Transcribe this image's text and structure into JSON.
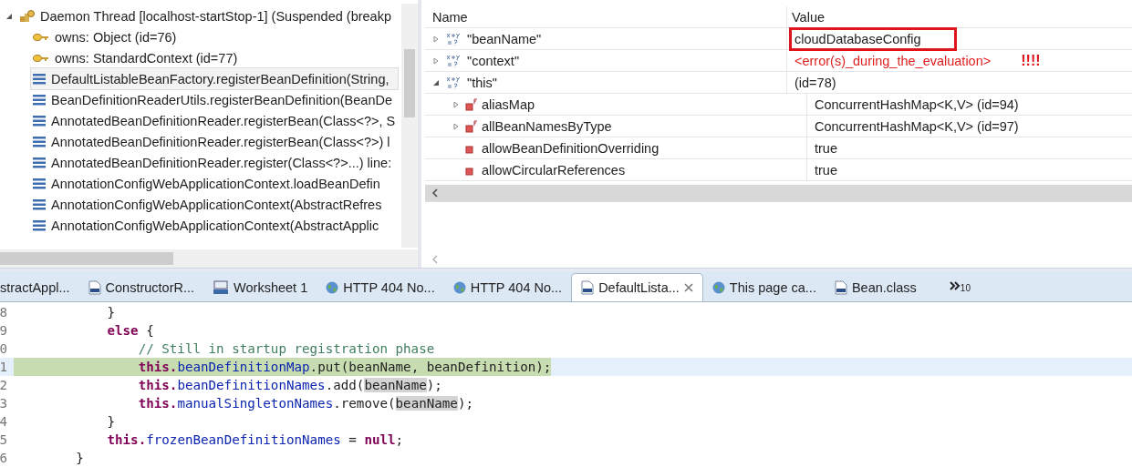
{
  "debug_tree": {
    "thread": {
      "label": "Daemon Thread [localhost-startStop-1] (Suspended (breakp",
      "expanded": true,
      "children": [
        {
          "kind": "monitor",
          "label": "owns: Object  (id=76)",
          "selected": false
        },
        {
          "kind": "monitor",
          "label": "owns: StandardContext  (id=77)",
          "selected": false
        },
        {
          "kind": "frame",
          "label": "DefaultListableBeanFactory.registerBeanDefinition(String,",
          "selected": true
        },
        {
          "kind": "frame",
          "label": "BeanDefinitionReaderUtils.registerBeanDefinition(BeanDe",
          "selected": false
        },
        {
          "kind": "frame",
          "label": "AnnotatedBeanDefinitionReader.registerBean(Class<?>, S",
          "selected": false
        },
        {
          "kind": "frame",
          "label": "AnnotatedBeanDefinitionReader.registerBean(Class<?>) l",
          "selected": false
        },
        {
          "kind": "frame",
          "label": "AnnotatedBeanDefinitionReader.register(Class<?>...) line:",
          "selected": false
        },
        {
          "kind": "frame",
          "label": "AnnotationConfigWebApplicationContext.loadBeanDefin",
          "selected": false
        },
        {
          "kind": "frame",
          "label": "AnnotationConfigWebApplicationContext(AbstractRefres",
          "selected": false
        },
        {
          "kind": "frame",
          "label": "AnnotationConfigWebApplicationContext(AbstractApplic",
          "selected": false
        }
      ]
    }
  },
  "variables": {
    "columns": [
      "Name",
      "Value"
    ],
    "rows": [
      {
        "kind": "local",
        "name": "\"beanName\"",
        "value": "cloudDatabaseConfig",
        "error": false,
        "expandable": true,
        "expanded": false,
        "annotated": true
      },
      {
        "kind": "local",
        "name": "\"context\"",
        "value": "<error(s)_during_the_evaluation>",
        "error": true,
        "expandable": true,
        "expanded": false,
        "annotated": false,
        "note": "!!!!"
      },
      {
        "kind": "local",
        "name": "\"this\"",
        "value": " (id=78)",
        "error": false,
        "expandable": true,
        "expanded": true,
        "annotated": false,
        "children": [
          {
            "kind": "final-field",
            "name": "aliasMap",
            "value": "ConcurrentHashMap<K,V>  (id=94)",
            "error": false,
            "expandable": true,
            "expanded": false,
            "annotated": false
          },
          {
            "kind": "final-field",
            "name": "allBeanNamesByType",
            "value": "ConcurrentHashMap<K,V>  (id=97)",
            "error": false,
            "expandable": true,
            "expanded": false,
            "annotated": false
          },
          {
            "kind": "field",
            "name": "allowBeanDefinitionOverriding",
            "value": "true",
            "error": false,
            "expandable": false,
            "annotated": false
          },
          {
            "kind": "field",
            "name": "allowCircularReferences",
            "value": "true",
            "error": false,
            "expandable": false,
            "annotated": false
          }
        ]
      }
    ]
  },
  "editor_tabs": {
    "overflow_count": "10",
    "tabs": [
      {
        "kind": "none",
        "label": "stractAppl...",
        "selected": false
      },
      {
        "kind": "class",
        "label": "ConstructorR...",
        "selected": false
      },
      {
        "kind": "sql",
        "label": "Worksheet 1",
        "selected": false
      },
      {
        "kind": "web",
        "label": "HTTP 404 No...",
        "selected": false
      },
      {
        "kind": "web",
        "label": "HTTP 404 No...",
        "selected": false
      },
      {
        "kind": "class",
        "label": "DefaultLista...",
        "selected": true
      },
      {
        "kind": "web",
        "label": "This page ca...",
        "selected": false
      },
      {
        "kind": "class",
        "label": "Bean.class",
        "selected": false
      }
    ]
  },
  "editor": {
    "lines": [
      {
        "number": "8",
        "current": false,
        "tokens": [
          {
            "kind": "plain",
            "text": "            }"
          }
        ]
      },
      {
        "number": "9",
        "current": false,
        "tokens": [
          {
            "kind": "keyword",
            "text": "            else"
          },
          {
            "kind": "plain",
            "text": " {"
          }
        ]
      },
      {
        "number": "0",
        "current": false,
        "tokens": [
          {
            "kind": "comment",
            "text": "                // Still in startup registration phase"
          }
        ]
      },
      {
        "number": "1",
        "current": true,
        "tokens": [
          {
            "kind": "keyword",
            "text": "                this."
          },
          {
            "kind": "field",
            "text": "beanDefinitionMap"
          },
          {
            "kind": "plain",
            "text": ".put(beanName, beanDefinition);"
          }
        ]
      },
      {
        "number": "2",
        "current": false,
        "tokens": [
          {
            "kind": "keyword",
            "text": "                this."
          },
          {
            "kind": "field",
            "text": "beanDefinitionNames"
          },
          {
            "kind": "plain",
            "text": ".add("
          },
          {
            "kind": "occurrence",
            "text": "beanName"
          },
          {
            "kind": "plain",
            "text": ");"
          }
        ]
      },
      {
        "number": "3",
        "current": false,
        "tokens": [
          {
            "kind": "keyword",
            "text": "                this."
          },
          {
            "kind": "field",
            "text": "manualSingletonNames"
          },
          {
            "kind": "plain",
            "text": ".remove("
          },
          {
            "kind": "occurrence",
            "text": "beanName"
          },
          {
            "kind": "plain",
            "text": ");"
          }
        ]
      },
      {
        "number": "4",
        "current": false,
        "tokens": [
          {
            "kind": "plain",
            "text": "            }"
          }
        ]
      },
      {
        "number": "5",
        "current": false,
        "tokens": [
          {
            "kind": "keyword",
            "text": "            this."
          },
          {
            "kind": "field",
            "text": "frozenBeanDefinitionNames"
          },
          {
            "kind": "plain",
            "text": " = "
          },
          {
            "kind": "keyword",
            "text": "null"
          },
          {
            "kind": "plain",
            "text": ";"
          }
        ]
      },
      {
        "number": "6",
        "current": false,
        "tokens": [
          {
            "kind": "plain",
            "text": "        }"
          }
        ]
      }
    ]
  }
}
